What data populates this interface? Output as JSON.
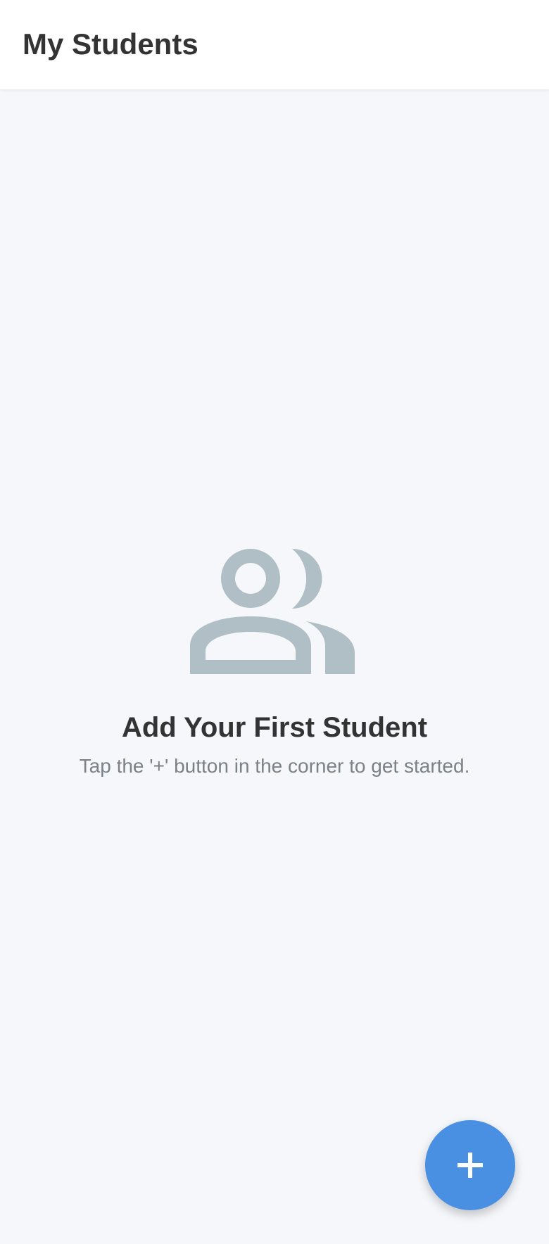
{
  "app_bar": {
    "title": "My Students"
  },
  "empty_state": {
    "icon": "people-icon",
    "icon_color": "#b0bec5",
    "title": "Add Your First Student",
    "subtitle": "Tap the '+' button in the corner to get started."
  },
  "fab": {
    "icon": "add-icon",
    "color": "#4a90e2"
  },
  "colors": {
    "background": "#f5f7fb",
    "app_bar": "#ffffff",
    "title_text": "#333333",
    "subtitle_text": "#7a8288"
  }
}
